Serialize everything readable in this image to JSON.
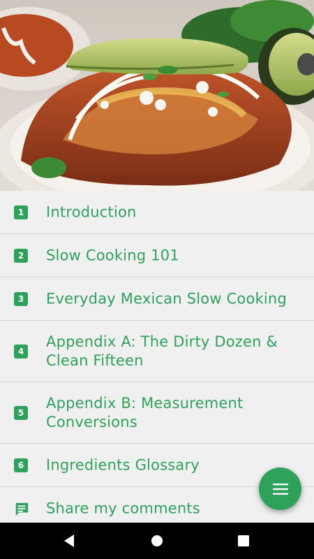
{
  "hero": {
    "image": "food-photo-enchilada-casserole"
  },
  "menu": {
    "items": [
      {
        "badge": "1",
        "label": "Introduction",
        "icon": "number-1-icon"
      },
      {
        "badge": "2",
        "label": "Slow Cooking 101",
        "icon": "number-2-icon"
      },
      {
        "badge": "3",
        "label": "Everyday Mexican Slow Cooking",
        "icon": "number-3-icon"
      },
      {
        "badge": "4",
        "label": "Appendix A: The Dirty Dozen & Clean Fifteen",
        "icon": "number-4-icon"
      },
      {
        "badge": "5",
        "label": "Appendix B: Measurement Conversions",
        "icon": "number-5-icon"
      },
      {
        "badge": "6",
        "label": "Ingredients Glossary",
        "icon": "number-6-icon"
      },
      {
        "label": "Share my comments",
        "icon": "comment-icon"
      }
    ]
  },
  "fab": {
    "icon": "menu-icon"
  },
  "colors": {
    "accent": "#2ea15a",
    "background": "#f0f0f0",
    "divider": "#d4d4d4",
    "navbar": "#000000"
  },
  "navbar": {
    "back_icon": "back-icon",
    "home_icon": "home-icon",
    "recents_icon": "recents-icon"
  }
}
